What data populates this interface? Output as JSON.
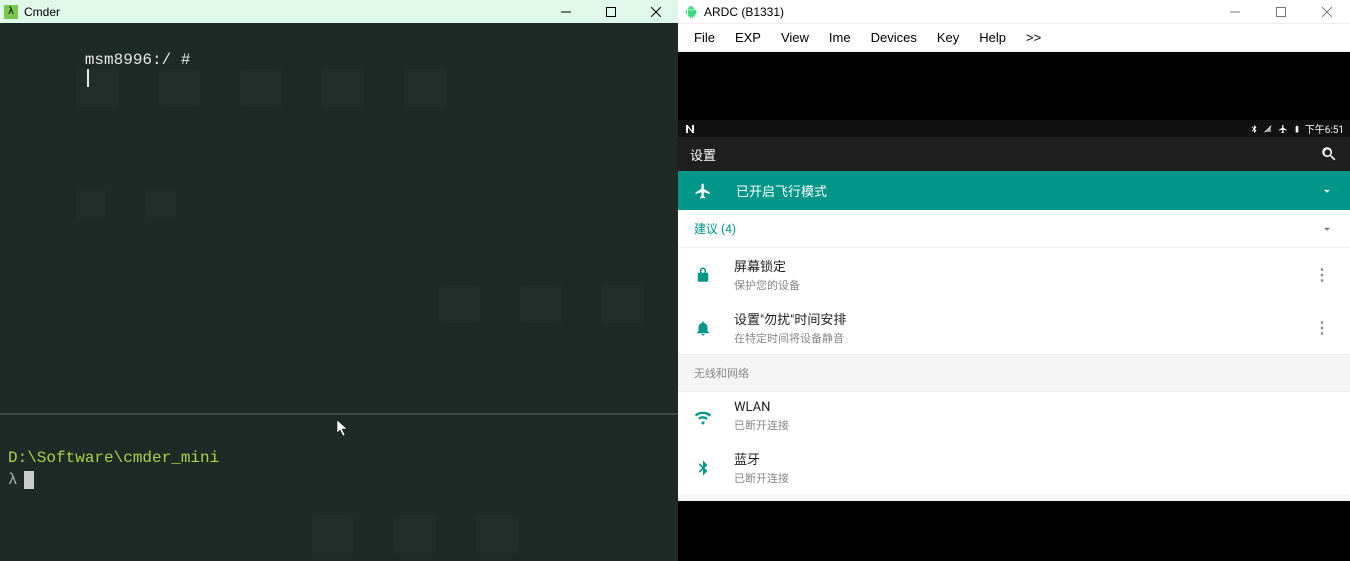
{
  "cmder": {
    "title": "Cmder",
    "top_prompt": "msm8996:/ #",
    "bottom_path": "D:\\Software\\cmder_mini",
    "bottom_prompt": "λ"
  },
  "ardc": {
    "title": "ARDC (B1331)",
    "menu": [
      "File",
      "EXP",
      "View",
      "Ime",
      "Devices",
      "Key",
      "Help",
      ">>"
    ]
  },
  "android": {
    "status_clock": "下午6:51",
    "appbar_title": "设置",
    "banner_text": "已开启飞行模式",
    "suggestions_label": "建议 (4)",
    "suggestions": [
      {
        "id": "screen-lock",
        "title": "屏幕锁定",
        "subtitle": "保护您的设备"
      },
      {
        "id": "dnd-schedule",
        "title": "设置\"勿扰\"时间安排",
        "subtitle": "在特定时间将设备静音"
      }
    ],
    "section_wireless": "无线和网络",
    "wireless_items": [
      {
        "id": "wlan",
        "title": "WLAN",
        "subtitle": "已断开连接"
      },
      {
        "id": "bluetooth",
        "title": "蓝牙",
        "subtitle": "已断开连接"
      }
    ]
  }
}
